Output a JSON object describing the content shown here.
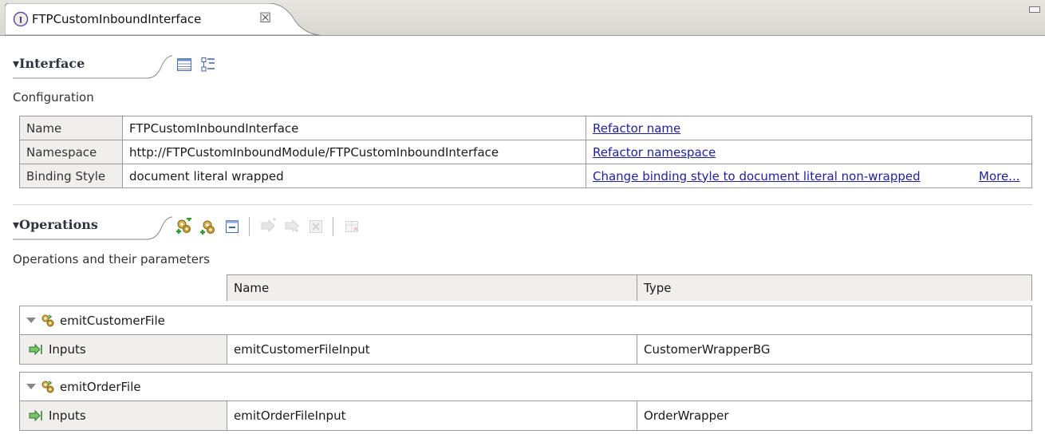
{
  "editor": {
    "tab_title": "FTPCustomInboundInterface",
    "tab_icon": "interface-icon",
    "close_glyph": "☒"
  },
  "interface_section": {
    "title": "▾Interface",
    "toolbar": [
      "table-view-icon",
      "tree-view-icon"
    ],
    "subtitle": "Configuration",
    "rows": [
      {
        "label": "Name",
        "value": "FTPCustomInboundInterface",
        "link": "Refactor name",
        "extra": ""
      },
      {
        "label": "Namespace",
        "value": "http://FTPCustomInboundModule/FTPCustomInboundInterface",
        "link": "Refactor namespace",
        "extra": ""
      },
      {
        "label": "Binding Style",
        "value": "document literal wrapped",
        "link": "Change binding style to document literal non-wrapped",
        "extra": "More..."
      }
    ]
  },
  "operations_section": {
    "title": "▾Operations",
    "toolbar": [
      "add-request-response-operation-icon",
      "add-one-way-operation-icon",
      "collapse-all-icon",
      "add-input-icon",
      "add-output-icon",
      "delete-icon",
      "add-fault-icon"
    ],
    "subtitle": "Operations and their parameters",
    "columns": {
      "name": "Name",
      "type": "Type"
    },
    "operations": [
      {
        "name": "emitCustomerFile",
        "param_kind": "Inputs",
        "param_name": "emitCustomerFileInput",
        "param_type": "CustomerWrapperBG"
      },
      {
        "name": "emitOrderFile",
        "param_kind": "Inputs",
        "param_name": "emitOrderFileInput",
        "param_type": "OrderWrapper"
      }
    ]
  },
  "colors": {
    "link": "#1f1f9e",
    "label_bg": "#f0efeb",
    "border": "#9a9a9a",
    "section_title": "#2d3440"
  }
}
